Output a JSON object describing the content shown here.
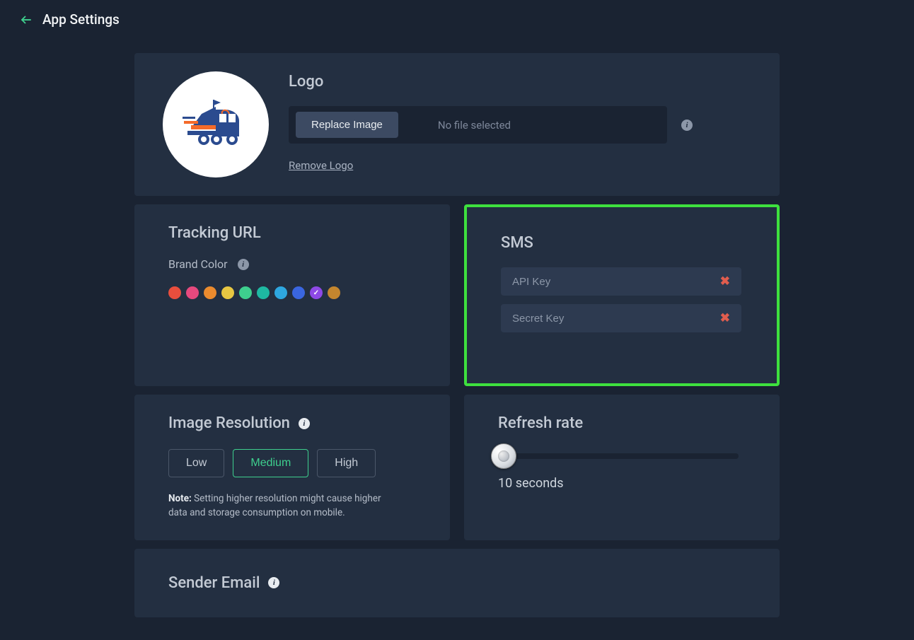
{
  "header": {
    "title": "App Settings"
  },
  "logo": {
    "title": "Logo",
    "replace_label": "Replace Image",
    "file_status": "No file selected",
    "remove_label": "Remove Logo"
  },
  "tracking": {
    "title": "Tracking URL",
    "brand_label": "Brand Color",
    "colors": [
      "#e94e3d",
      "#e6497e",
      "#eb8b2e",
      "#e8c742",
      "#3ecf8e",
      "#1eb9a2",
      "#2ea7e0",
      "#3a66e0",
      "#8e49e6",
      "#c4862e"
    ],
    "selected_index": 8
  },
  "sms": {
    "title": "SMS",
    "api_key_placeholder": "API Key",
    "secret_key_placeholder": "Secret Key"
  },
  "resolution": {
    "title": "Image Resolution",
    "options": [
      "Low",
      "Medium",
      "High"
    ],
    "selected_index": 1,
    "note_prefix": "Note:",
    "note_text": " Setting higher resolution might cause higher data and storage consumption on mobile."
  },
  "refresh": {
    "title": "Refresh rate",
    "value_label": "10 seconds"
  },
  "sender": {
    "title": "Sender Email"
  }
}
